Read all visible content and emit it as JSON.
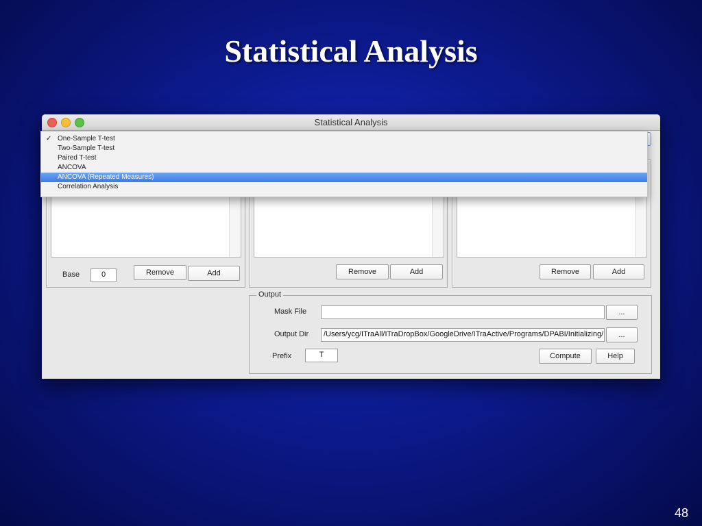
{
  "slide": {
    "title": "Statistical Analysis",
    "number": "48"
  },
  "window": {
    "title": "Statistical Analysis",
    "controls": [
      "close",
      "minimize",
      "zoom"
    ]
  },
  "dropdown": {
    "checked_index": 0,
    "highlighted_index": 4,
    "check_mark": "✓",
    "items": [
      "One-Sample T-test",
      "Two-Sample T-test",
      "Paired T-test",
      "ANCOVA",
      "ANCOVA (Repeated Measures)",
      "Correlation Analysis"
    ]
  },
  "groups": {
    "group1": {
      "base_label": "Base",
      "base_value": "0",
      "remove_label": "Remove",
      "add_label": "Add"
    },
    "group2": {
      "remove_label": "Remove",
      "add_label": "Add"
    },
    "group3": {
      "remove_label": "Remove",
      "add_label": "Add"
    }
  },
  "output": {
    "legend": "Output",
    "mask_file_label": "Mask File",
    "mask_file_value": "",
    "mask_browse_label": "...",
    "output_dir_label": "Output Dir",
    "output_dir_value": "/Users/ycg/ITraAll/ITraDropBox/GoogleDrive/ITraActive/Programs/DPABI/Initializing/",
    "output_dir_browse_label": "...",
    "prefix_label": "Prefix",
    "prefix_value": "T",
    "compute_label": "Compute",
    "help_label": "Help"
  }
}
